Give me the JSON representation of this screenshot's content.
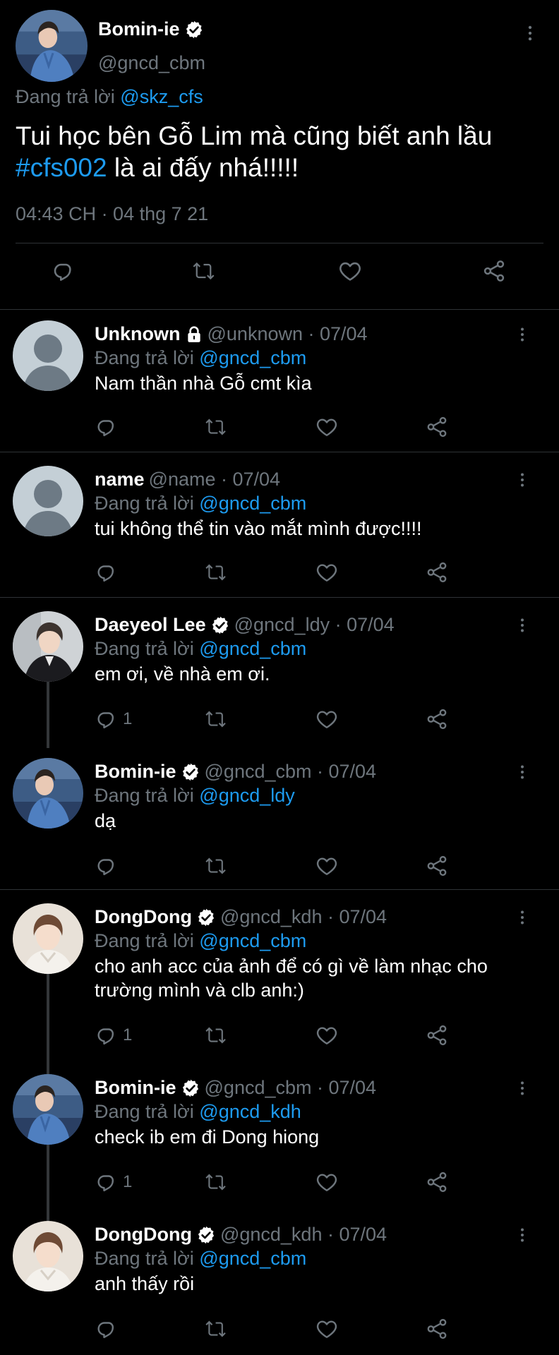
{
  "main_tweet": {
    "author_name": "Bomin-ie",
    "author_handle": "@gncd_cbm",
    "replying_prefix": "Đang trả lời",
    "replying_to": "@skz_cfs",
    "text_part1": "Tui học bên Gỗ Lim mà cũng biết anh lầu",
    "hashtag": "#cfs002",
    "text_part2": "là ai đấy nhá!!!!!",
    "timestamp": "04:43 CH · 04 thg 7 21"
  },
  "replies": [
    {
      "name": "Unknown",
      "handle": "@unknown · 07/04",
      "replying_prefix": "Đang trả lời",
      "replying_to": "@gncd_cbm",
      "text": "Nam thần nhà Gỗ cmt kìa",
      "reply_count": ""
    },
    {
      "name": "name",
      "handle": "@name · 07/04",
      "replying_prefix": "Đang trả lời",
      "replying_to": "@gncd_cbm",
      "text": "tui không thể tin vào mắt mình được!!!!",
      "reply_count": ""
    },
    {
      "name": "Daeyeol Lee",
      "handle": "@gncd_ldy · 07/04",
      "replying_prefix": "Đang trả lời",
      "replying_to": "@gncd_cbm",
      "text": "em ơi, về nhà em ơi.",
      "reply_count": "1"
    },
    {
      "name": "Bomin-ie",
      "handle": "@gncd_cbm · 07/04",
      "replying_prefix": "Đang trả lời",
      "replying_to": "@gncd_ldy",
      "text": "dạ",
      "reply_count": ""
    },
    {
      "name": "DongDong",
      "handle": "@gncd_kdh · 07/04",
      "replying_prefix": "Đang trả lời",
      "replying_to": "@gncd_cbm",
      "text": "cho anh acc của ảnh để có gì về làm nhạc cho trường mình và clb anh:)",
      "reply_count": "1"
    },
    {
      "name": "Bomin-ie",
      "handle": "@gncd_cbm · 07/04",
      "replying_prefix": "Đang trả lời",
      "replying_to": "@gncd_kdh",
      "text": "check ib em đi Dong hiong",
      "reply_count": "1"
    },
    {
      "name": "DongDong",
      "handle": "@gncd_kdh · 07/04",
      "replying_prefix": "Đang trả lời",
      "replying_to": "@gncd_cbm",
      "text": "anh thấy rồi",
      "reply_count": ""
    }
  ],
  "icons": {
    "reply": "reply-icon",
    "retweet": "retweet-icon",
    "like": "heart-icon",
    "share": "share-icon",
    "more": "more-icon",
    "verified": "verified-icon",
    "lock": "lock-icon"
  },
  "colors": {
    "background": "#000000",
    "text": "#e7e9ea",
    "muted": "#6e767d",
    "link": "#1d9bf0",
    "divider": "#2f3336"
  }
}
